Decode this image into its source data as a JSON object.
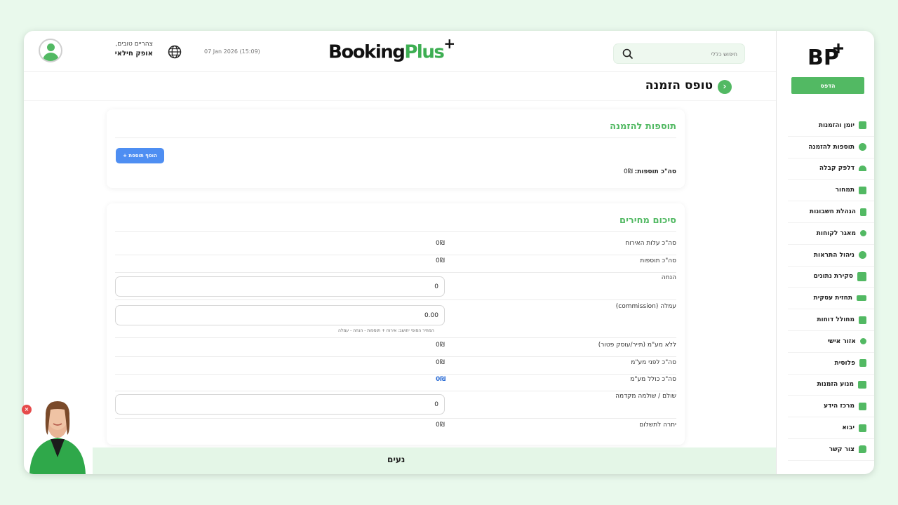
{
  "sidebar": {
    "logo": "BP+",
    "print_label": "הדפס",
    "items": [
      {
        "label": "יומן והזמנות",
        "icon": "calendar-icon"
      },
      {
        "label": "תוספות להזמנה",
        "icon": "addons-icon"
      },
      {
        "label": "דלפק קבלה",
        "icon": "reception-bell-icon"
      },
      {
        "label": "תמחור",
        "icon": "pricing-icon"
      },
      {
        "label": "הנהלת חשבונות",
        "icon": "accounting-icon"
      },
      {
        "label": "מאגר לקוחות",
        "icon": "customers-icon"
      },
      {
        "label": "ניהול התראות",
        "icon": "alerts-gear-icon"
      },
      {
        "label": "סקירת נתונים",
        "icon": "dashboard-icon"
      },
      {
        "label": "תחזית עסקית",
        "icon": "forecast-icon"
      },
      {
        "label": "מחולל דוחות",
        "icon": "reports-icon"
      },
      {
        "label": "אזור אישי",
        "icon": "personal-area-icon"
      },
      {
        "label": "פלוסית",
        "icon": "plusit-icon"
      },
      {
        "label": "מנוע הזמנות",
        "icon": "booking-engine-icon"
      },
      {
        "label": "מרכז הידע",
        "icon": "knowledge-center-icon"
      },
      {
        "label": "יבוא",
        "icon": "import-icon"
      },
      {
        "label": "צור קשר",
        "icon": "contact-chat-icon"
      }
    ]
  },
  "header": {
    "greeting": "צהריים טובים,",
    "user_name": "אופק חילאי",
    "datetime": "07 Jan 2026 (15:09)",
    "brand_booking": "Booking",
    "brand_plus": "Plus",
    "brand_sup": "+",
    "search_placeholder": "חיפוש כללי"
  },
  "page": {
    "title": "טופס הזמנה"
  },
  "addons_card": {
    "title": "תוספות להזמנה",
    "add_button": "+ הוסף תוספת",
    "total_label": "סה\"כ תוספות:",
    "total_value": "0₪"
  },
  "price_summary": {
    "title": "סיכום מחירים",
    "hosting_cost_label": "סה\"כ עלות האירוח",
    "hosting_cost_value": "0₪",
    "addons_total_label": "סה\"כ תוספות",
    "addons_total_value": "0₪",
    "discount_label": "הנחה",
    "discount_value": "0",
    "commission_label": "עמלה (commission)",
    "commission_value": "0.00",
    "commission_hint": "המחיר הסופי יחושב: אירוח + תוספות - הנחה - עמלה",
    "no_vat_label": "ללא מע\"מ (תייר/עוסק פטור)",
    "no_vat_value": "0₪",
    "before_vat_label": "סה\"כ לפני מע\"מ",
    "before_vat_value": "0₪",
    "incl_vat_label": "סה\"כ כולל מע\"מ",
    "incl_vat_value": "0₪",
    "paid_label": "שולם / שולמה מקדמה",
    "paid_value": "0",
    "balance_label": "יתרה לתשלום",
    "balance_value": "0₪"
  },
  "bottom_bar": {
    "text": "נעים"
  },
  "colors": {
    "accent_green": "#52b963",
    "button_blue": "#4e8ef2",
    "background": "#e9f9ec"
  }
}
